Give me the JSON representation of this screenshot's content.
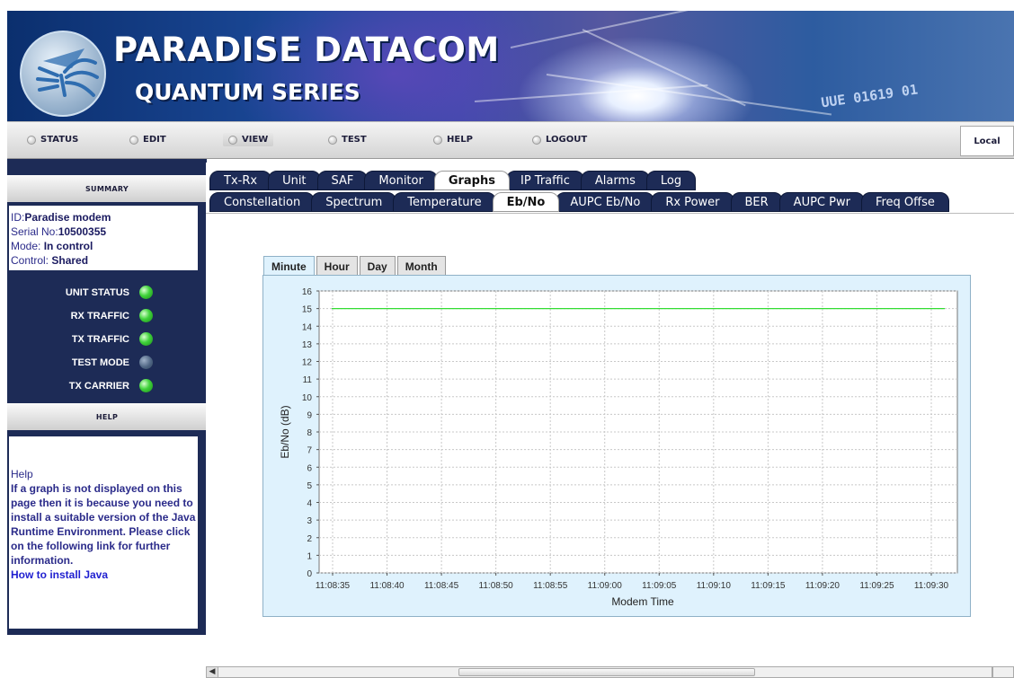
{
  "banner": {
    "title": "PARADISE DATACOM",
    "subtitle": "QUANTUM SERIES",
    "digits": "UUE 01619 01"
  },
  "nav": {
    "items": [
      {
        "label": "STATUS"
      },
      {
        "label": "EDIT"
      },
      {
        "label": "VIEW"
      },
      {
        "label": "TEST"
      },
      {
        "label": "HELP"
      },
      {
        "label": "LOGOUT"
      }
    ],
    "local": "Local"
  },
  "sidebar": {
    "summary_header": "SUMMARY",
    "id_label": "ID:",
    "id_value": "Paradise  modem",
    "serial_label": "Serial No:",
    "serial_value": "10500355",
    "mode_label": "Mode: ",
    "mode_value": "In control",
    "control_label": "Control: ",
    "control_value": "Shared",
    "status": [
      {
        "label": "UNIT STATUS",
        "state": "on"
      },
      {
        "label": "RX TRAFFIC",
        "state": "on"
      },
      {
        "label": "TX TRAFFIC",
        "state": "on"
      },
      {
        "label": "TEST MODE",
        "state": "off"
      },
      {
        "label": "TX CARRIER",
        "state": "on"
      }
    ],
    "help_header": "HELP",
    "help_title": "Help",
    "help_text": "If a graph is not displayed on this page then it is because you need to install a suitable version of the Java Runtime Environment. Please click on the following link for further information.",
    "help_link": "How to install Java"
  },
  "tabs": {
    "row1": [
      "Tx-Rx",
      "Unit",
      "SAF",
      "Monitor",
      "Graphs",
      "IP Traffic",
      "Alarms",
      "Log"
    ],
    "row1_selected": 4,
    "row2": [
      "Constellation",
      "Spectrum",
      "Temperature",
      "Eb/No",
      "AUPC Eb/No",
      "Rx Power",
      "BER",
      "AUPC Pwr",
      "Freq Offse"
    ],
    "row2_selected": 3
  },
  "chart_tabs": {
    "items": [
      "Minute",
      "Hour",
      "Day",
      "Month"
    ],
    "selected": 0
  },
  "colors": {
    "line": "#33dd33",
    "plot_bg": "#ffffff",
    "panel_bg": "#dff2fd",
    "tab_dark": "#1d2b56"
  },
  "chart_data": {
    "type": "line",
    "xlabel": "Modem Time",
    "ylabel": "Eb/No (dB)",
    "ylim": [
      0,
      16
    ],
    "yticks": [
      0,
      1,
      2,
      3,
      4,
      5,
      6,
      7,
      8,
      9,
      10,
      11,
      12,
      13,
      14,
      15,
      16
    ],
    "x": [
      "11:08:35",
      "11:08:40",
      "11:08:45",
      "11:08:50",
      "11:08:55",
      "11:09:00",
      "11:09:05",
      "11:09:10",
      "11:09:15",
      "11:09:20",
      "11:09:25",
      "11:09:30"
    ],
    "series": [
      {
        "values": [
          15,
          15,
          15,
          15,
          15,
          15,
          15,
          15,
          15,
          15,
          15,
          15
        ]
      }
    ],
    "grid": true
  }
}
